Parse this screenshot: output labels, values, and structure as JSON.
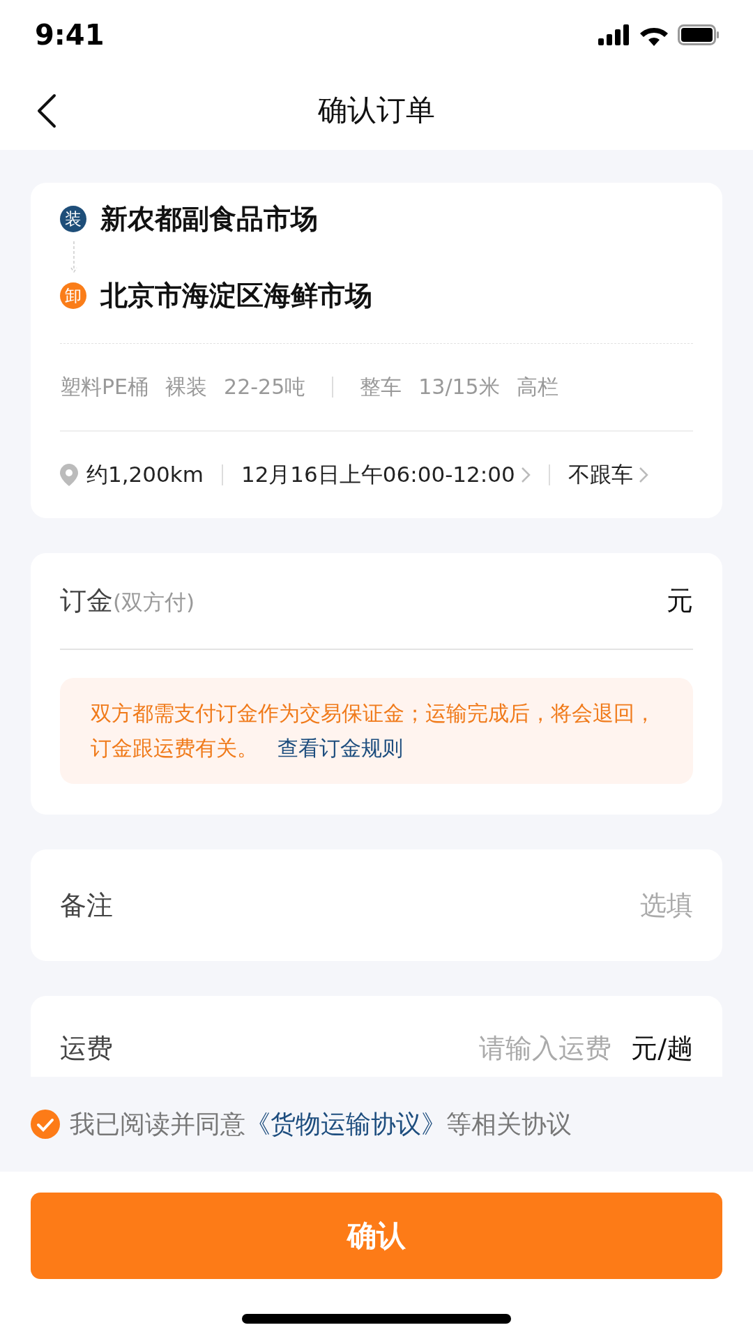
{
  "status_bar": {
    "time": "9:41"
  },
  "nav": {
    "title": "确认订单"
  },
  "route": {
    "stops": [
      {
        "badge": "装",
        "name": "新农都副食品市场",
        "color": "#1e4e79"
      },
      {
        "badge": "卸",
        "name": "北京市海淀区海鲜市场",
        "color": "#fa7d19"
      }
    ],
    "cargo": [
      "塑料PE桶",
      "裸装",
      "22-25吨"
    ],
    "vehicle": [
      "整车",
      "13/15米",
      "高栏"
    ],
    "distance": "约1,200km",
    "time": "12月16日上午06:00-12:00",
    "follow": "不跟车"
  },
  "deposit": {
    "label": "订金",
    "hint": "(双方付)",
    "unit": "元",
    "notice": "双方都需支付订金作为交易保证金；运输完成后，将会退回，订金跟运费有关。",
    "rule_link": "查看订金规则"
  },
  "remark": {
    "label": "备注",
    "placeholder": "选填"
  },
  "freight": {
    "label": "运费",
    "placeholder": "请输入运费",
    "unit": "元/趟"
  },
  "agreement": {
    "checked": true,
    "prefix": "我已阅读并同意",
    "link": "《货物运输协议》",
    "suffix": "等相关协议"
  },
  "confirm_button": "确认"
}
